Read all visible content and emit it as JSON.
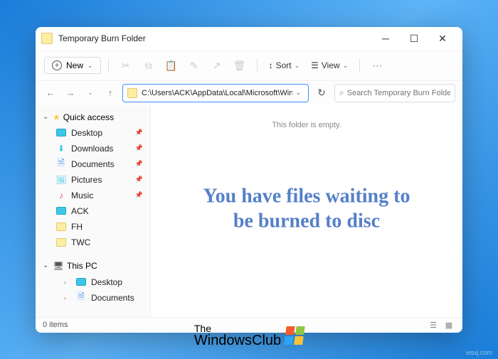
{
  "window": {
    "title": "Temporary Burn Folder"
  },
  "toolbar": {
    "new_label": "New",
    "sort_label": "Sort",
    "view_label": "View"
  },
  "address": {
    "path": "C:\\Users\\ACK\\AppData\\Local\\Microsoft\\Windows\\Burn\\Burn"
  },
  "search": {
    "placeholder": "Search Temporary Burn Folder"
  },
  "sidebar": {
    "quick_access": "Quick access",
    "this_pc": "This PC",
    "items": [
      {
        "label": "Desktop",
        "icon": "monitor",
        "pinned": true
      },
      {
        "label": "Downloads",
        "icon": "download",
        "pinned": true
      },
      {
        "label": "Documents",
        "icon": "document",
        "pinned": true
      },
      {
        "label": "Pictures",
        "icon": "picture",
        "pinned": true
      },
      {
        "label": "Music",
        "icon": "music",
        "pinned": true
      },
      {
        "label": "ACK",
        "icon": "folder",
        "pinned": false
      },
      {
        "label": "FH",
        "icon": "folder",
        "pinned": false
      },
      {
        "label": "TWC",
        "icon": "folder",
        "pinned": false
      }
    ],
    "pc_items": [
      {
        "label": "Desktop"
      },
      {
        "label": "Documents"
      }
    ]
  },
  "content": {
    "empty": "This folder is empty."
  },
  "footer": {
    "count": "0 items"
  },
  "overlay": {
    "text": "You have files waiting to be burned to disc"
  },
  "watermark": {
    "line1": "The",
    "line2": "WindowsClub",
    "corner": "wsxj.com"
  }
}
